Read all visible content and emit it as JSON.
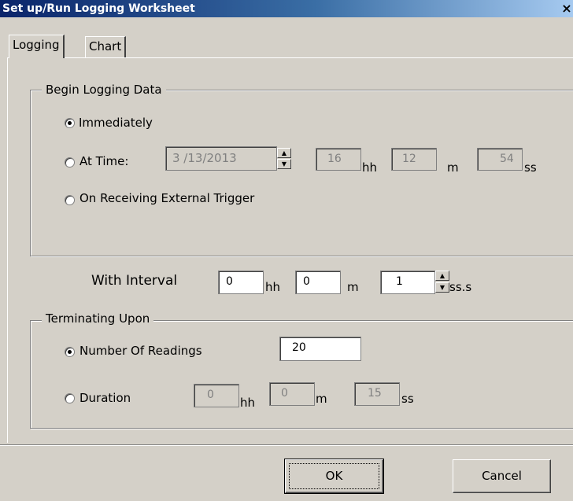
{
  "window": {
    "title": "Set up/Run Logging Worksheet",
    "close_glyph": "×"
  },
  "tabs": [
    {
      "label": "Logging",
      "active": true
    },
    {
      "label": "Chart",
      "active": false
    }
  ],
  "begin_group": {
    "legend": "Begin Logging Data",
    "options": [
      {
        "label": "Immediately",
        "selected": true
      },
      {
        "label": "At Time:",
        "selected": false
      },
      {
        "label": "On Receiving External Trigger",
        "selected": false
      }
    ],
    "date_value": "3 /13/2013",
    "hh_value": "16",
    "hh_unit": "hh",
    "m_value": "12",
    "m_unit": "m",
    "ss_value": "54",
    "ss_unit": "ss"
  },
  "interval": {
    "label": "With Interval",
    "hh_value": "0",
    "hh_unit": "hh",
    "m_value": "0",
    "m_unit": "m",
    "ss_value": "1",
    "ss_unit": "ss.s"
  },
  "terminate_group": {
    "legend": "Terminating Upon",
    "options": [
      {
        "label": "Number Of Readings",
        "selected": true
      },
      {
        "label": "Duration",
        "selected": false
      }
    ],
    "readings_value": "20",
    "duration_hh": "0",
    "hh_unit": "hh",
    "duration_m": "0",
    "m_unit": "m",
    "duration_ss": "15",
    "ss_unit": "ss"
  },
  "buttons": {
    "ok": "OK",
    "cancel": "Cancel"
  },
  "icons": {
    "spin_up": "spin-up-arrow-icon",
    "spin_down": "spin-down-arrow-icon"
  },
  "colors": {
    "title_start": "#0a246a",
    "title_end": "#a6caf0",
    "face": "#d4d0c8"
  }
}
